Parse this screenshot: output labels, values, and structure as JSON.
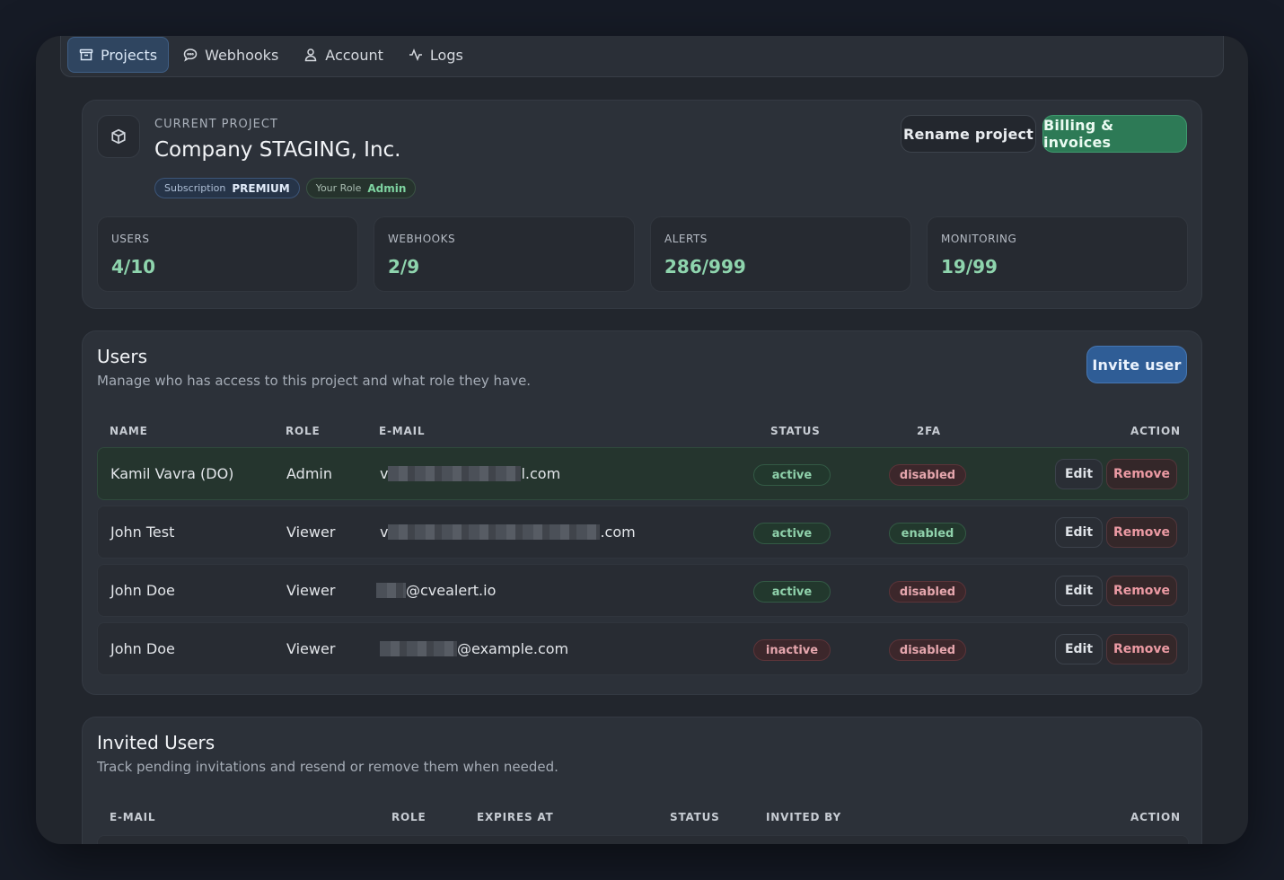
{
  "nav": {
    "items": [
      {
        "label": "Projects",
        "icon": "archive-icon",
        "active": true
      },
      {
        "label": "Webhooks",
        "icon": "chat-bubble-icon",
        "active": false
      },
      {
        "label": "Account",
        "icon": "user-icon",
        "active": false
      },
      {
        "label": "Logs",
        "icon": "activity-icon",
        "active": false
      }
    ]
  },
  "project": {
    "eyebrow": "CURRENT PROJECT",
    "name": "Company STAGING, Inc.",
    "subscription_label": "Subscription",
    "subscription_value": "PREMIUM",
    "role_label": "Your Role",
    "role_value": "Admin",
    "rename_label": "Rename project",
    "billing_label": "Billing & invoices",
    "stats": [
      {
        "label": "USERS",
        "value": "4/10"
      },
      {
        "label": "WEBHOOKS",
        "value": "2/9"
      },
      {
        "label": "ALERTS",
        "value": "286/999"
      },
      {
        "label": "MONITORING",
        "value": "19/99"
      }
    ]
  },
  "users": {
    "title": "Users",
    "subtitle": "Manage who has access to this project and what role they have.",
    "invite_label": "Invite user",
    "columns": [
      "NAME",
      "ROLE",
      "E-MAIL",
      "STATUS",
      "2FA",
      "ACTION"
    ],
    "rows": [
      {
        "name": "Kamil Vavra (DO)",
        "role": "Admin",
        "email_prefix": "v",
        "email_suffix": "l.com",
        "status": "active",
        "twofa": "disabled"
      },
      {
        "name": "John Test",
        "role": "Viewer",
        "email_prefix": "v",
        "email_suffix": ".com",
        "status": "active",
        "twofa": "enabled"
      },
      {
        "name": "John Doe",
        "role": "Viewer",
        "email_prefix": "",
        "email_suffix": "@cvealert.io",
        "status": "active",
        "twofa": "disabled"
      },
      {
        "name": "John Doe",
        "role": "Viewer",
        "email_prefix": "",
        "email_suffix": "@example.com",
        "status": "inactive",
        "twofa": "disabled"
      }
    ],
    "edit_label": "Edit",
    "remove_label": "Remove"
  },
  "invited": {
    "title": "Invited Users",
    "subtitle": "Track pending invitations and resend or remove them when needed.",
    "columns": [
      "E-MAIL",
      "ROLE",
      "EXPIRES AT",
      "STATUS",
      "INVITED BY",
      "ACTION"
    ]
  },
  "colors": {
    "accent_blue": "#2f5d96",
    "accent_green": "#2d7a56",
    "status_ok": "#8fd1ab",
    "status_bad": "#e6a7ae"
  }
}
